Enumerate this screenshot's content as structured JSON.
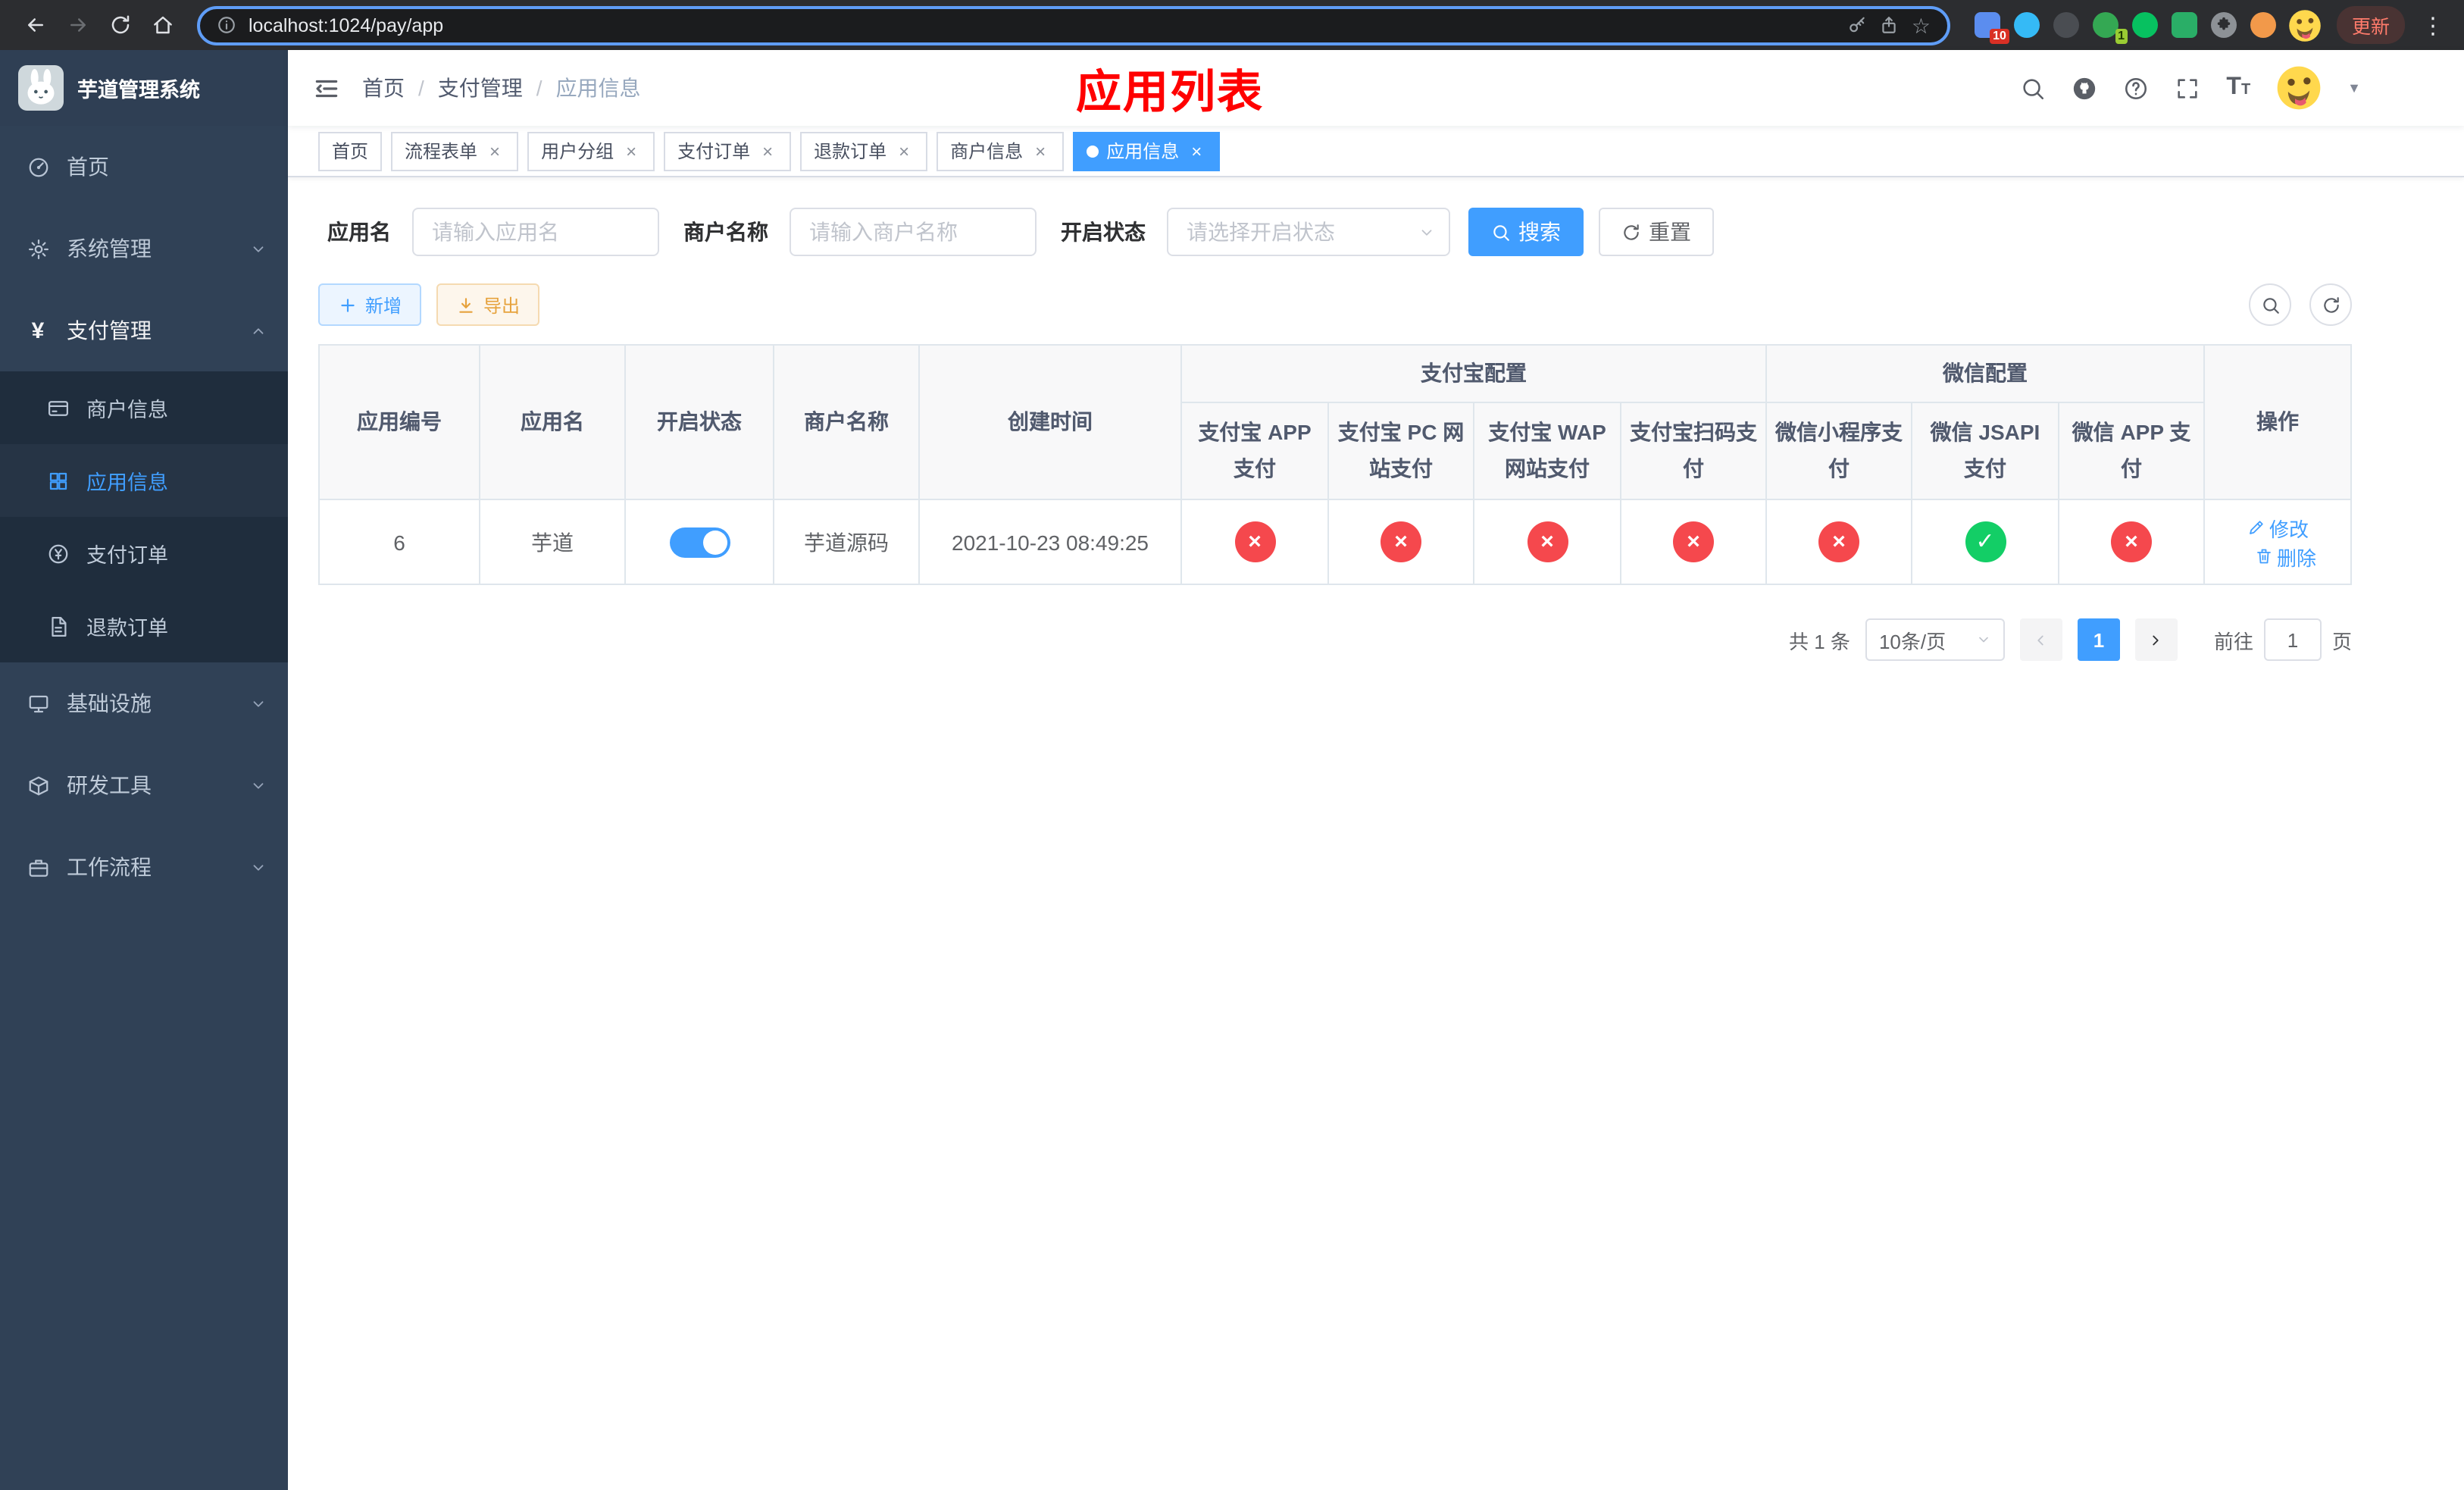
{
  "colors": {
    "accent_blue": "#409eff",
    "success_green": "#13ce66",
    "danger_red": "#f5484d",
    "title_red": "#ff0000",
    "sidebar_bg": "#304156",
    "sidebar_sub_bg": "#1f2d3d"
  },
  "icons": {
    "close": "×",
    "star": "☆",
    "kebab": "⋮",
    "caret_down": "▼",
    "check": "✓",
    "cross": "×"
  },
  "browser": {
    "url": "localhost:1024/pay/app",
    "update_button": "更新",
    "ext_badge_count": "10",
    "ext_badge_count2": "1"
  },
  "sidebar": {
    "logo_title": "芋道管理系统",
    "item_home": "首页",
    "item_system": "系统管理",
    "item_pay": "支付管理",
    "sub_merchant_info": "商户信息",
    "sub_app_info": "应用信息",
    "sub_pay_order": "支付订单",
    "sub_refund_order": "退款订单",
    "item_infra": "基础设施",
    "item_dev_tools": "研发工具",
    "item_workflow": "工作流程"
  },
  "header": {
    "breadcrumb": [
      "首页",
      "支付管理",
      "应用信息"
    ],
    "page_title": "应用列表"
  },
  "tabs": [
    {
      "label": "首页",
      "closable": false,
      "active": false
    },
    {
      "label": "流程表单",
      "closable": true,
      "active": false
    },
    {
      "label": "用户分组",
      "closable": true,
      "active": false
    },
    {
      "label": "支付订单",
      "closable": true,
      "active": false
    },
    {
      "label": "退款订单",
      "closable": true,
      "active": false
    },
    {
      "label": "商户信息",
      "closable": true,
      "active": false
    },
    {
      "label": "应用信息",
      "closable": true,
      "active": true
    }
  ],
  "filters": {
    "app_name_label": "应用名",
    "app_name_placeholder": "请输入应用名",
    "merchant_label": "商户名称",
    "merchant_placeholder": "请输入商户名称",
    "status_label": "开启状态",
    "status_placeholder": "请选择开启状态",
    "search_button": "搜索",
    "reset_button": "重置"
  },
  "toolbar": {
    "add_button": "新增",
    "export_button": "导出"
  },
  "table": {
    "columns": {
      "app_id": "应用编号",
      "app_name": "应用名",
      "status": "开启状态",
      "merchant_name": "商户名称",
      "create_time": "创建时间",
      "alipay_group": "支付宝配置",
      "wechat_group": "微信配置",
      "alipay_app": "支付宝 APP 支付",
      "alipay_pc": "支付宝 PC 网站支付",
      "alipay_wap": "支付宝 WAP 网站支付",
      "alipay_scan": "支付宝扫码支付",
      "wechat_mini": "微信小程序支付",
      "wechat_jsapi": "微信 JSAPI 支付",
      "wechat_app": "微信 APP 支付",
      "actions": "操作"
    },
    "rows": [
      {
        "app_id": "6",
        "app_name": "芋道",
        "status_on": true,
        "merchant_name": "芋道源码",
        "create_time": "2021-10-23 08:49:25",
        "pay_status": [
          "cross",
          "cross",
          "cross",
          "cross",
          "cross",
          "check",
          "cross"
        ],
        "edit_label": "修改",
        "delete_label": "删除"
      }
    ]
  },
  "pagination": {
    "total": "共 1 条",
    "page_size": "10条/页",
    "current_page": "1",
    "goto_label": "前往",
    "goto_value": "1",
    "goto_unit": "页"
  }
}
